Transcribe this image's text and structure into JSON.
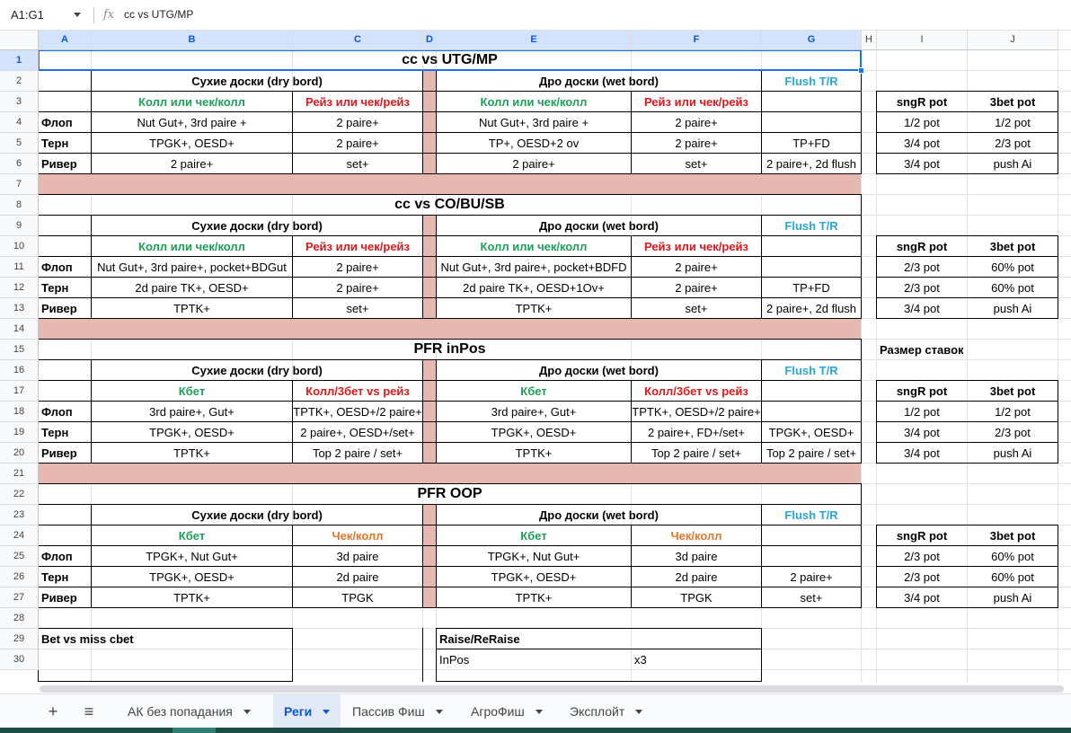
{
  "formula_bar": {
    "cell_ref": "A1:G1",
    "fx": "fx",
    "formula": "cc vs UTG/MP"
  },
  "columns": [
    "A",
    "B",
    "C",
    "D",
    "E",
    "F",
    "G",
    "H",
    "I",
    "J"
  ],
  "rows": [
    "1",
    "2",
    "3",
    "4",
    "5",
    "6",
    "7",
    "8",
    "9",
    "10",
    "11",
    "12",
    "13",
    "14",
    "15",
    "16",
    "17",
    "18",
    "19",
    "20",
    "21",
    "22",
    "23",
    "24",
    "25",
    "26",
    "27",
    "28",
    "29",
    "30"
  ],
  "sections": [
    {
      "title": "cc vs UTG/MP",
      "dry": "Сухие доски (dry bord)",
      "wet": "Дро доски (wet bord)",
      "flush": "Flush T/R",
      "h_b": "Колл или чек/колл",
      "h_c": "Рейз или чек/рейз",
      "h_e": "Колл или чек/колл",
      "h_f": "Рейз или чек/рейз",
      "rows": [
        {
          "label": "Флоп",
          "b": "Nut Gut+, 3rd paire +",
          "c": "2 paire+",
          "e": "Nut Gut+, 3rd paire +",
          "f": "2 paire+",
          "g": ""
        },
        {
          "label": "Терн",
          "b": "TPGK+, OESD+",
          "c": "2 paire+",
          "e": "TP+, OESD+2 ov",
          "f": "2 paire+",
          "g": "TP+FD"
        },
        {
          "label": "Ривер",
          "b": "2 paire+",
          "c": "set+",
          "e": "2 paire+",
          "f": "set+",
          "g": "2 paire+, 2d flush"
        }
      ],
      "side": {
        "h1": "sngR pot",
        "h2": "3bet pot",
        "rows": [
          [
            "1/2 pot",
            "1/2 pot"
          ],
          [
            "3/4 pot",
            "2/3 pot"
          ],
          [
            "3/4 pot",
            "push Ai"
          ]
        ]
      }
    },
    {
      "title": "cc  vs CO/BU/SB",
      "dry": "Сухие доски (dry bord)",
      "wet": "Дро доски (wet bord)",
      "flush": "Flush T/R",
      "h_b": "Колл или чек/колл",
      "h_c": "Рейз или чек/рейз",
      "h_e": "Колл или чек/колл",
      "h_f": "Рейз или чек/рейз",
      "rows": [
        {
          "label": "Флоп",
          "b": "Nut Gut+, 3rd paire+, pocket+BDGut",
          "c": "2 paire+",
          "e": "Nut Gut+, 3rd paire+, pocket+BDFD",
          "f": "2 paire+",
          "g": ""
        },
        {
          "label": "Терн",
          "b": "2d paire TK+, OESD+",
          "c": "2 paire+",
          "e": "2d paire TK+, OESD+1Ov+",
          "f": "2 paire+",
          "g": "TP+FD"
        },
        {
          "label": "Ривер",
          "b": "TPTK+",
          "c": "set+",
          "e": "TPTK+",
          "f": "set+",
          "g": "2 paire+, 2d flush"
        }
      ],
      "side": {
        "h1": "sngR pot",
        "h2": "3bet pot",
        "rows": [
          [
            "2/3 pot",
            "60% pot"
          ],
          [
            "2/3 pot",
            "60% pot"
          ],
          [
            "3/4 pot",
            "push Ai"
          ]
        ]
      }
    },
    {
      "title": "PFR  inPos",
      "dry": "Сухие доски (dry bord)",
      "wet": "Дро доски (wet bord)",
      "flush": "Flush T/R",
      "h_b": "Кбет",
      "h_c": "Колл/3бет vs рейз",
      "h_e": "Кбет",
      "h_f": "Колл/3бет vs рейз",
      "rows": [
        {
          "label": "Флоп",
          "b": "3rd paire+, Gut+",
          "c": "TPTK+, OESD+/2 paire+",
          "e": "3rd paire+, Gut+",
          "f": "TPTK+, OESD+/2 paire+",
          "g": ""
        },
        {
          "label": "Терн",
          "b": "TPGK+, OESD+",
          "c": "2 paire+, OESD+/set+",
          "e": "TPGK+, OESD+",
          "f": "2 paire+, FD+/set+",
          "g": "TPGK+, OESD+"
        },
        {
          "label": "Ривер",
          "b": "TPTK+",
          "c": "Top 2 paire / set+",
          "e": "TPTK+",
          "f": "Top 2 paire / set+",
          "g": "Top 2 paire / set+"
        }
      ],
      "side_title": "Размер ставок",
      "side": {
        "h1": "sngR pot",
        "h2": "3bet pot",
        "rows": [
          [
            "1/2 pot",
            "1/2 pot"
          ],
          [
            "3/4 pot",
            "2/3 pot"
          ],
          [
            "3/4 pot",
            "push Ai"
          ]
        ]
      }
    },
    {
      "title": "PFR  OOP",
      "dry": "Сухие доски (dry bord)",
      "wet": "Дро доски (wet bord)",
      "flush": "Flush T/R",
      "h_b": "Кбет",
      "h_c": "Чек/колл",
      "h_e": "Кбет",
      "h_f": "Чек/колл",
      "rows": [
        {
          "label": "Флоп",
          "b": "TPGK+, Nut Gut+",
          "c": "3d paire",
          "e": "TPGK+, Nut Gut+",
          "f": "3d paire",
          "g": ""
        },
        {
          "label": "Терн",
          "b": "TPGK+, OESD+",
          "c": "2d paire",
          "e": "TPGK+, OESD+",
          "f": "2d paire",
          "g": "2 paire+"
        },
        {
          "label": "Ривер",
          "b": "TPTK+",
          "c": "TPGK",
          "e": "TPTK+",
          "f": "TPGK",
          "g": "set+"
        }
      ],
      "side": {
        "h1": "sngR pot",
        "h2": "3bet pot",
        "rows": [
          [
            "2/3 pot",
            "60% pot"
          ],
          [
            "2/3 pot",
            "60% pot"
          ],
          [
            "3/4 pot",
            "push Ai"
          ]
        ]
      }
    }
  ],
  "bottom": {
    "bet_vs_miss": "Bet vs miss cbet",
    "raise_title": "Raise/ReRaise",
    "inpos_label": "InPos",
    "inpos_value": "x3"
  },
  "tabs": {
    "add_icon": "plus-icon",
    "list_icon": "menu-icon",
    "items": [
      "АК без попадания",
      "Реги",
      "Пассив Фиш",
      "АгроФиш",
      "Эксплойт"
    ],
    "active_index": 1
  },
  "colors": {
    "green": "#1e9e58",
    "red": "#e0181c",
    "blue": "#27a6d8",
    "orange": "#e2762b",
    "separator_pink": "#e6b8af",
    "selection": "#1a73e8"
  }
}
